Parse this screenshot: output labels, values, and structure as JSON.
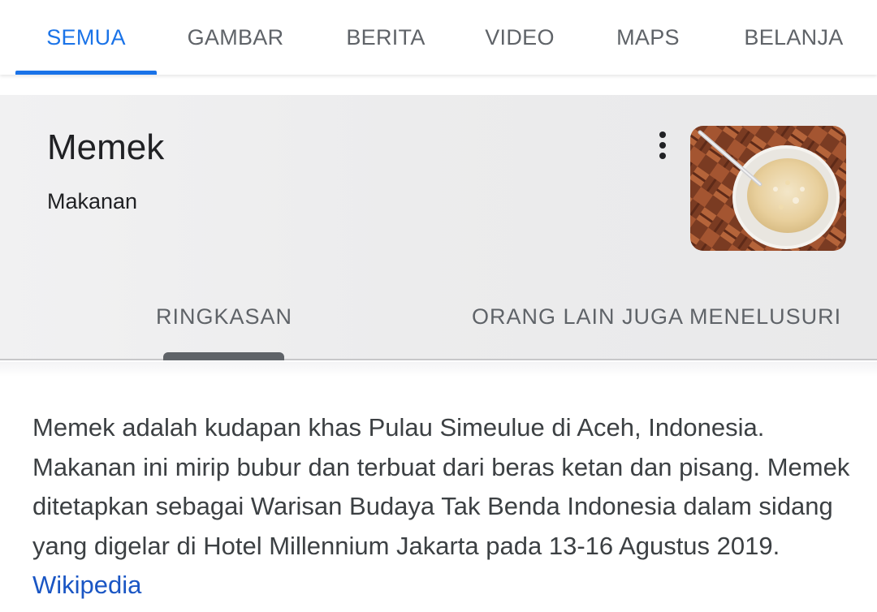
{
  "tabs": [
    {
      "label": "SEMUA",
      "active": true
    },
    {
      "label": "GAMBAR",
      "active": false
    },
    {
      "label": "BERITA",
      "active": false
    },
    {
      "label": "VIDEO",
      "active": false
    },
    {
      "label": "MAPS",
      "active": false
    },
    {
      "label": "BELANJA",
      "active": false
    }
  ],
  "panel": {
    "title": "Memek",
    "subtitle": "Makanan",
    "more_icon": "more-vert-icon",
    "image": "bowl-of-porridge-thumbnail",
    "tabs": [
      {
        "label": "RINGKASAN",
        "active": true
      },
      {
        "label": "ORANG LAIN JUGA MENELUSURI",
        "active": false
      }
    ]
  },
  "description": {
    "text": "Memek adalah kudapan khas Pulau Simeulue di Aceh, Indonesia. Makanan ini mirip bubur dan terbuat dari beras ketan dan pisang. Memek ditetapkan sebagai Warisan Budaya Tak Benda Indonesia dalam sidang yang digelar di Hotel Millennium Jakarta pada 13-16 Agustus 2019.",
    "source_link": "Wikipedia"
  },
  "colors": {
    "accent": "#1a73e8",
    "link": "#1a56c4",
    "tab_text": "#5f6368",
    "panel_bg": "#ececed"
  }
}
